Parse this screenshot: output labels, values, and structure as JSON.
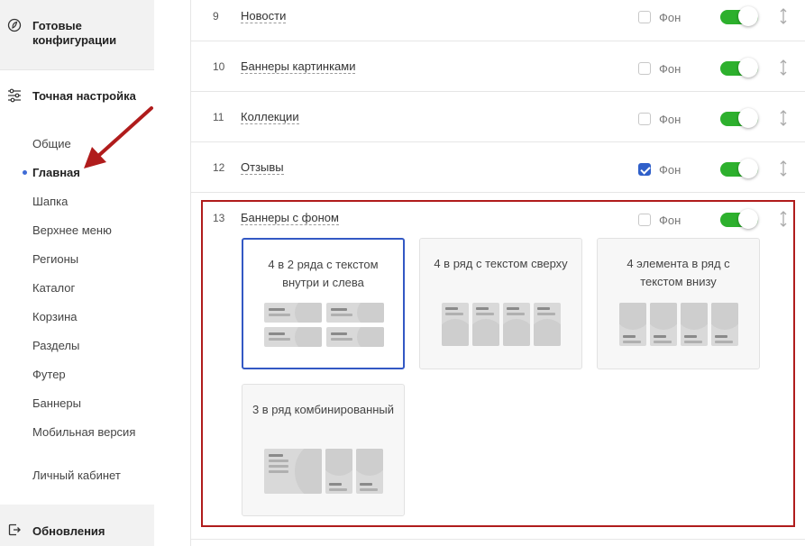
{
  "sidebar": {
    "ready_configs": "Готовые конфигурации",
    "fine_tuning": "Точная настройка",
    "updates": "Обновления",
    "items": [
      {
        "label": "Общие"
      },
      {
        "label": "Главная"
      },
      {
        "label": "Шапка"
      },
      {
        "label": "Верхнее меню"
      },
      {
        "label": "Регионы"
      },
      {
        "label": "Каталог"
      },
      {
        "label": "Корзина"
      },
      {
        "label": "Разделы"
      },
      {
        "label": "Футер"
      },
      {
        "label": "Баннеры"
      },
      {
        "label": "Мобильная версия"
      },
      {
        "label": "Личный кабинет"
      }
    ],
    "active_item": "Главная"
  },
  "rows": [
    {
      "num": "9",
      "name": "Новости",
      "bg_label": "Фон",
      "bg_checked": false,
      "enabled": true
    },
    {
      "num": "10",
      "name": "Баннеры картинками",
      "bg_label": "Фон",
      "bg_checked": false,
      "enabled": true
    },
    {
      "num": "11",
      "name": "Коллекции",
      "bg_label": "Фон",
      "bg_checked": false,
      "enabled": true
    },
    {
      "num": "12",
      "name": "Отзывы",
      "bg_label": "Фон",
      "bg_checked": true,
      "enabled": true
    },
    {
      "num": "13",
      "name": "Баннеры с фоном",
      "bg_label": "Фон",
      "bg_checked": false,
      "enabled": true
    }
  ],
  "layout_options": [
    {
      "label": "4 в 2 ряда с текстом внутри и слева",
      "selected": true
    },
    {
      "label": "4 в ряд с текстом сверху",
      "selected": false
    },
    {
      "label": "4 элемента в ряд с текстом внизу",
      "selected": false
    },
    {
      "label": "3 в ряд комбинированный",
      "selected": false
    }
  ],
  "colors": {
    "accent": "#2f5fc9",
    "toggle_on": "#2db02d",
    "highlight": "#b01c1c",
    "sidebar_bg": "#f2f2f2"
  }
}
